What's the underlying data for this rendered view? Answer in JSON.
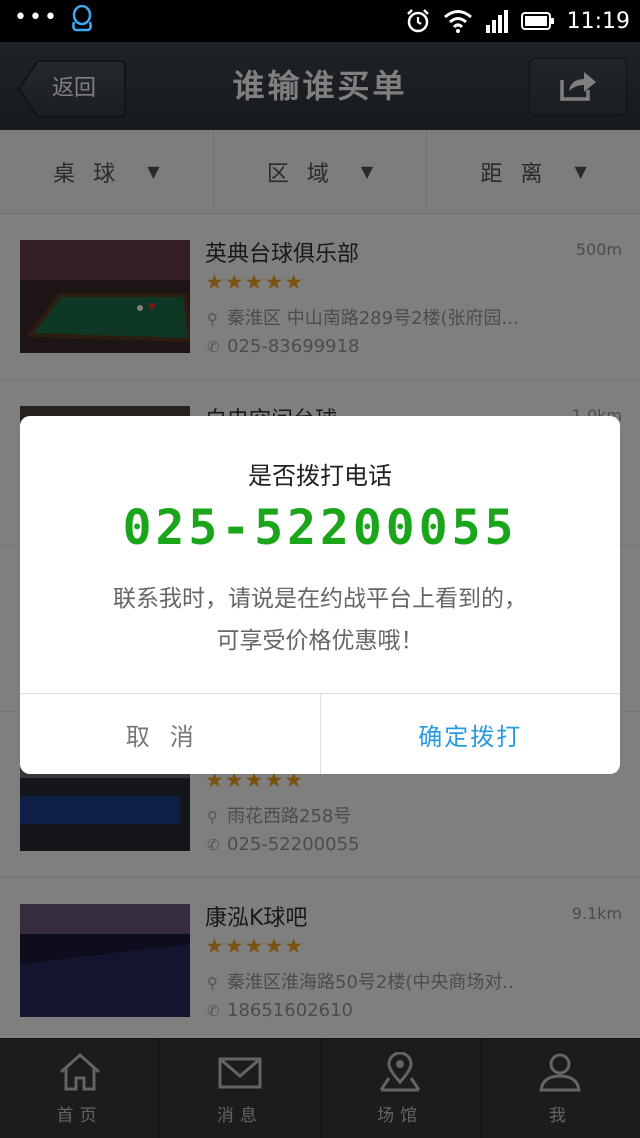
{
  "status_bar": {
    "dots": "•••",
    "time": "11:19"
  },
  "nav": {
    "back_label": "返回",
    "title": "谁输谁买单"
  },
  "filters": [
    {
      "label": "桌球",
      "arrow": "▼"
    },
    {
      "label": "区域",
      "arrow": "▼"
    },
    {
      "label": "距离",
      "arrow": "▼"
    }
  ],
  "venues": [
    {
      "name": "英典台球俱乐部",
      "distance": "500m",
      "stars": "★★★★★",
      "address": "秦淮区 中山南路289号2楼(张府园...",
      "phone": "025-83699918"
    },
    {
      "name": "白电空间台球",
      "distance": "1.0km",
      "stars": "★★★★★",
      "address": "",
      "phone": ""
    },
    {
      "name": "",
      "distance": "",
      "stars": "★★★★★",
      "address": "",
      "phone": ""
    },
    {
      "name": "",
      "distance": "",
      "stars": "★★★★★",
      "address": "雨花西路258号",
      "phone": "025-52200055"
    },
    {
      "name": "康泓K球吧",
      "distance": "9.1km",
      "stars": "★★★★★",
      "address": "秦淮区淮海路50号2楼(中央商场对..",
      "phone": "18651602610"
    }
  ],
  "tabs": [
    {
      "label": "首页"
    },
    {
      "label": "消息"
    },
    {
      "label": "场馆"
    },
    {
      "label": "我"
    }
  ],
  "dialog": {
    "title": "是否拨打电话",
    "phone": "025-52200055",
    "message_line1": "联系我时，请说是在约战平台上看到的，",
    "message_line2": "可享受价格优惠哦！",
    "cancel_label": "取消",
    "confirm_label": "确定拨打"
  },
  "colors": {
    "phone_green": "#1aa51a",
    "confirm_blue": "#2a9ae0",
    "star_orange": "#f5a623",
    "nav_bg": "#353c44"
  },
  "icons": {
    "status_left": "qq-penguin-icon",
    "status_right": [
      "alarm-icon",
      "wifi-icon",
      "signal-icon",
      "battery-icon"
    ],
    "share": "share-icon",
    "address": "location-pin-icon",
    "phone": "phone-icon",
    "tabs": [
      "home-icon",
      "mail-icon",
      "map-pin-icon",
      "user-icon"
    ]
  }
}
